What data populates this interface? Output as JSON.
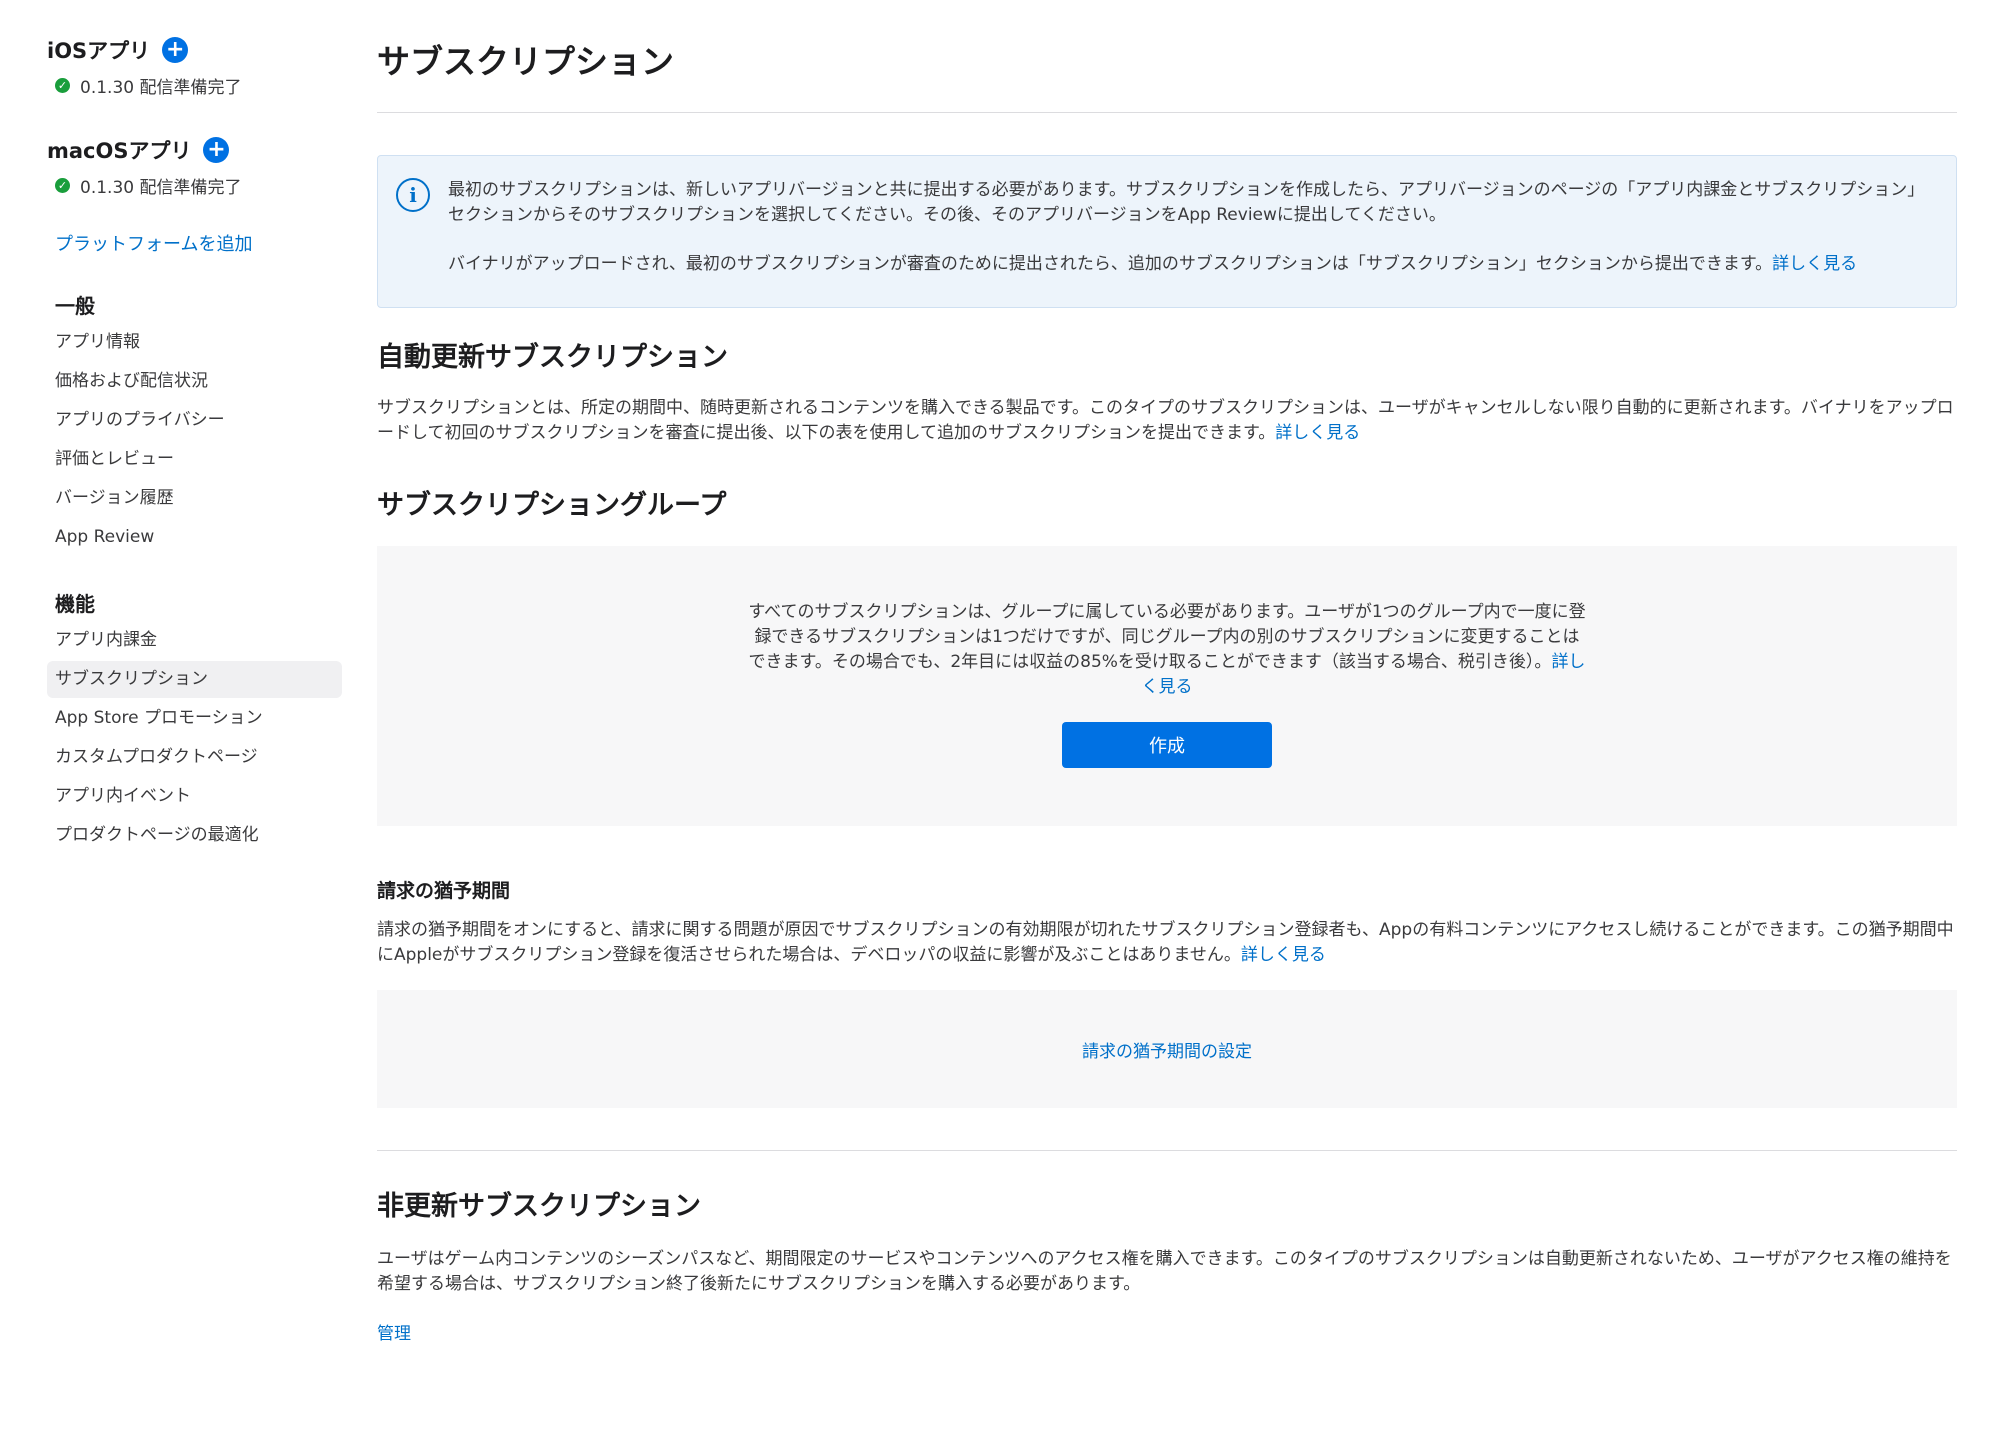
{
  "sidebar": {
    "platforms": [
      {
        "title": "iOSアプリ",
        "status": "0.1.30 配信準備完了"
      },
      {
        "title": "macOSアプリ",
        "status": "0.1.30 配信準備完了"
      }
    ],
    "add_platform": "プラットフォームを追加",
    "general": {
      "title": "一般",
      "items": [
        "アプリ情報",
        "価格および配信状況",
        "アプリのプライバシー",
        "評価とレビュー",
        "バージョン履歴",
        "App Review"
      ]
    },
    "features": {
      "title": "機能",
      "items": [
        "アプリ内課金",
        "サブスクリプション",
        "App Store プロモーション",
        "カスタムプロダクトページ",
        "アプリ内イベント",
        "プロダクトページの最適化"
      ],
      "active_index": 1
    }
  },
  "main": {
    "title": "サブスクリプション",
    "info": {
      "paragraph1": "最初のサブスクリプションは、新しいアプリバージョンと共に提出する必要があります。サブスクリプションを作成したら、アプリバージョンのページの「アプリ内課金とサブスクリプション」セクションからそのサブスクリプションを選択してください。その後、そのアプリバージョンをApp Reviewに提出してください。",
      "paragraph2": "バイナリがアップロードされ、最初のサブスクリプションが審査のために提出されたら、追加のサブスクリプションは「サブスクリプション」セクションから提出できます。",
      "learn_more": "詳しく見る"
    },
    "auto_renew": {
      "title": "自動更新サブスクリプション",
      "text": "サブスクリプションとは、所定の期間中、随時更新されるコンテンツを購入できる製品です。このタイプのサブスクリプションは、ユーザがキャンセルしない限り自動的に更新されます。バイナリをアップロードして初回のサブスクリプションを審査に提出後、以下の表を使用して追加のサブスクリプションを提出できます。",
      "learn_more": "詳しく見る"
    },
    "groups": {
      "title": "サブスクリプショングループ",
      "text": "すべてのサブスクリプションは、グループに属している必要があります。ユーザが1つのグループ内で一度に登録できるサブスクリプションは1つだけですが、同じグループ内の別のサブスクリプションに変更することはできます。その場合でも、2年目には収益の85%を受け取ることができます（該当する場合、税引き後）。",
      "learn_more": "詳しく見る",
      "create_button": "作成"
    },
    "grace": {
      "title": "請求の猶予期間",
      "text": "請求の猶予期間をオンにすると、請求に関する問題が原因でサブスクリプションの有効期限が切れたサブスクリプション登録者も、Appの有料コンテンツにアクセスし続けることができます。この猶予期間中にAppleがサブスクリプション登録を復活させられた場合は、デベロッパの収益に影響が及ぶことはありません。",
      "learn_more": "詳しく見る",
      "settings_link": "請求の猶予期間の設定"
    },
    "non_renewing": {
      "title": "非更新サブスクリプション",
      "text": "ユーザはゲーム内コンテンツのシーズンパスなど、期間限定のサービスやコンテンツへのアクセス権を購入できます。このタイプのサブスクリプションは自動更新されないため、ユーザがアクセス権の維持を希望する場合は、サブスクリプション終了後新たにサブスクリプションを購入する必要があります。",
      "manage_link": "管理"
    }
  },
  "icons": {
    "plus": "plus-icon",
    "status": "check-circle-icon",
    "info": "info-icon"
  },
  "colors": {
    "accent": "#0071e3",
    "link": "#0070c9",
    "status_ready": "#1a9e3c",
    "info_background": "#edf4fb"
  }
}
